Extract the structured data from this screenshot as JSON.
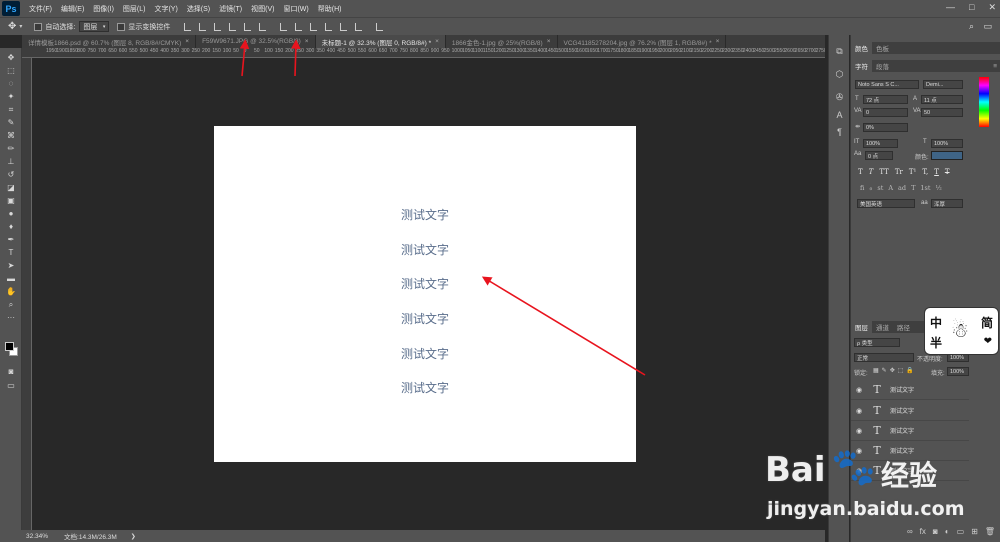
{
  "menubar": {
    "logo": "Ps",
    "items": [
      "文件(F)",
      "编辑(E)",
      "图像(I)",
      "图层(L)",
      "文字(Y)",
      "选择(S)",
      "滤镜(T)",
      "视图(V)",
      "窗口(W)",
      "帮助(H)"
    ],
    "win_min": "—",
    "win_max": "□",
    "win_close": "✕"
  },
  "options": {
    "auto_select_label": "自动选择:",
    "auto_select_value": "图层",
    "show_transform_label": "显示变换控件"
  },
  "tabs": [
    {
      "label": "详情模板1866.psd @ 60.7% (图层 8, RGB/8#/CMYK)",
      "close": "×"
    },
    {
      "label": "F59W9671.JPG @ 32.5%(RGB/8)",
      "close": "×"
    },
    {
      "label": "未标题-1 @ 32.3% (图层 0, RGB/8#) *",
      "close": "×"
    },
    {
      "label": "1866金色-1.jpg @ 25%(RGB/8)",
      "close": "×"
    },
    {
      "label": "VCG41185278204.jpg @ 76.2% (图层 1, RGB/8#) *",
      "close": "×"
    }
  ],
  "ruler_ticks": [
    "1950",
    "1900",
    "1850",
    "800",
    "750",
    "700",
    "650",
    "600",
    "550",
    "500",
    "450",
    "400",
    "350",
    "300",
    "250",
    "200",
    "150",
    "100",
    "50",
    "0",
    "50",
    "100",
    "150",
    "200",
    "250",
    "300",
    "350",
    "400",
    "450",
    "500",
    "550",
    "600",
    "650",
    "700",
    "750",
    "800",
    "850",
    "900",
    "950",
    "1000",
    "1050",
    "1100",
    "1150",
    "1200",
    "1250",
    "1300",
    "1350",
    "1400",
    "1450",
    "1500",
    "1550",
    "1600",
    "1650",
    "1700",
    "1750",
    "1800",
    "1850",
    "1900",
    "1950",
    "2000",
    "2050",
    "2100",
    "2150",
    "2200",
    "2250",
    "2300",
    "2350",
    "2400",
    "2450",
    "2500",
    "2550",
    "2600",
    "2650",
    "2700",
    "2750",
    "2800"
  ],
  "canvas": {
    "texts": [
      "测试文字",
      "测试文字",
      "测试文字",
      "测试文字",
      "测试文字",
      "测试文字"
    ],
    "text_color": "#5a6e8c",
    "arrow_color": "#e8141e"
  },
  "status": {
    "zoom": "32.34%",
    "doc_info": "文档:14.3M/26.3M"
  },
  "color_panel": {
    "tabs": [
      "颜色",
      "色板"
    ]
  },
  "char_panel": {
    "tabs": [
      "字符",
      "段落"
    ],
    "font_family": "Noto Sans S C...",
    "font_style": "Demi...",
    "font_size": "72 点",
    "leading": "11 点",
    "kerning": "0",
    "tracking": "50",
    "scale_pct": "0%",
    "vertical_scale": "100%",
    "horizontal_scale": "100%",
    "baseline": "0 点",
    "color_label": "颜色:",
    "color_swatch": "#3f6486",
    "style_buttons": [
      "T",
      "T",
      "TT",
      "Tr",
      "T¹",
      "T,",
      "T",
      "T"
    ],
    "opentype_buttons": [
      "fi",
      "ℴ",
      "st",
      "A",
      "ad",
      "T",
      "1st",
      "½"
    ],
    "language": "美国英语",
    "aa_aa": "aa",
    "antialias": "浑厚"
  },
  "layers_panel": {
    "tabs": [
      "图层",
      "通道",
      "路径"
    ],
    "filter_label": "ρ 类型",
    "blend_mode": "正常",
    "opacity_label": "不透明度:",
    "opacity": "100%",
    "lock_label": "锁定:",
    "fill_label": "填充:",
    "fill": "100%",
    "layers": [
      "测试文字",
      "测试文字",
      "测试文字",
      "测试文字",
      "测试文字"
    ]
  },
  "watermarks": {
    "baidu": "Bai",
    "jingyan": "经验",
    "domain": "jingyan.baidu.com",
    "badge_zhong": "中",
    "badge_jian": "简",
    "badge_ban": "半"
  }
}
